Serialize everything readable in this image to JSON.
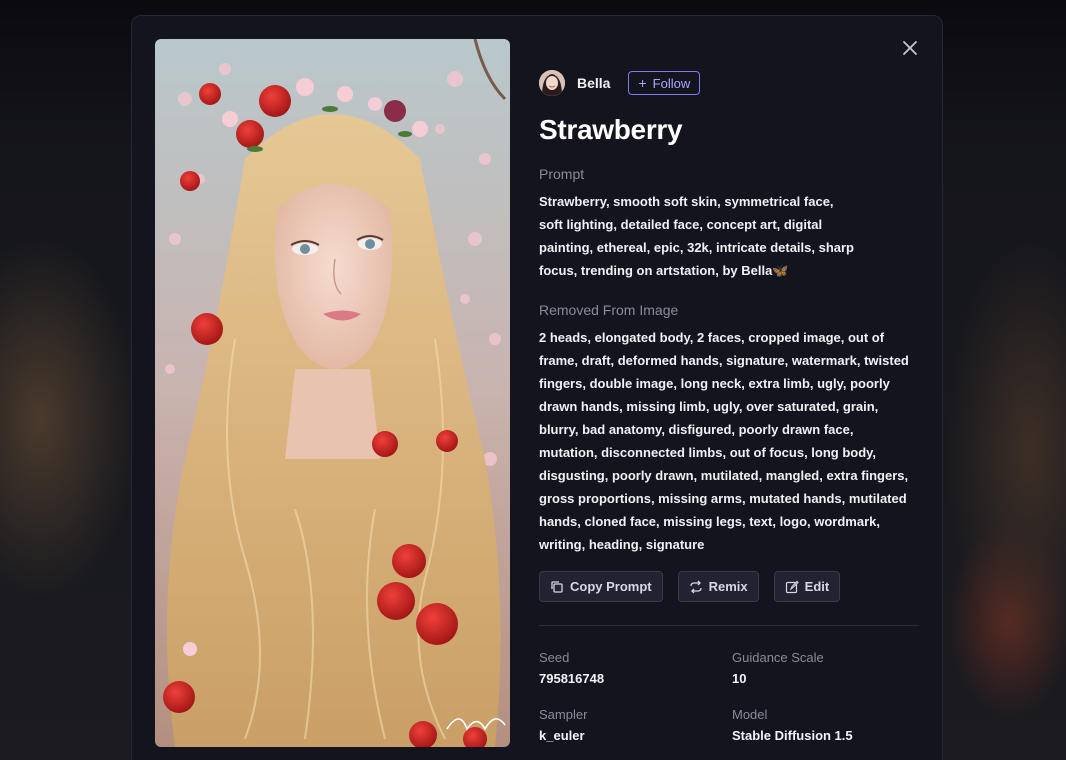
{
  "author": {
    "name": "Bella",
    "follow_label": "Follow"
  },
  "title": "Strawberry",
  "prompt": {
    "label": "Prompt",
    "text": "Strawberry, smooth soft skin, symmetrical face, soft lighting, detailed face, concept art, digital painting, ethereal, epic, 32k, intricate details, sharp focus, trending on artstation, by Bella🦋"
  },
  "removed": {
    "label": "Removed From Image",
    "text": "2 heads, elongated body, 2 faces, cropped image, out of frame, draft, deformed hands, signature, watermark, twisted fingers, double image, long neck, extra limb, ugly, poorly drawn hands, missing limb, ugly, over saturated, grain, blurry, bad anatomy, disfigured, poorly drawn face, mutation, disconnected limbs, out of focus, long body, disgusting, poorly drawn, mutilated, mangled, extra fingers, gross proportions, missing arms, mutated hands, mutilated hands, cloned face, missing legs, text, logo, wordmark, writing, heading, signature"
  },
  "actions": {
    "copy_prompt": "Copy Prompt",
    "remix": "Remix",
    "edit": "Edit"
  },
  "meta": {
    "seed_label": "Seed",
    "seed": "795816748",
    "guidance_label": "Guidance Scale",
    "guidance": "10",
    "sampler_label": "Sampler",
    "sampler": "k_euler",
    "model_label": "Model",
    "model": "Stable Diffusion 1.5"
  },
  "icons": {
    "close": "close-icon",
    "plus": "plus-icon",
    "copy": "copy-icon",
    "remix": "repeat-icon",
    "edit": "edit-icon"
  },
  "colors": {
    "accent": "#7b7bf2",
    "modal_bg": "#14141f",
    "button_bg": "#222232"
  }
}
